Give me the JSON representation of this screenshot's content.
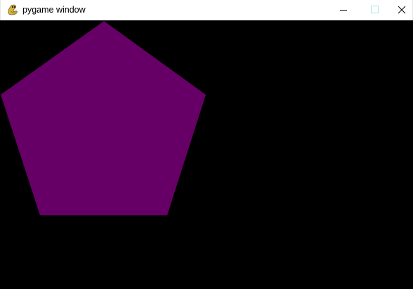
{
  "window": {
    "title": "pygame window",
    "icon": "pygame-snake-icon"
  },
  "controls": {
    "minimize_icon": "minimize-icon",
    "maximize_icon": "maximize-icon",
    "close_icon": "close-icon"
  },
  "canvas": {
    "background_color": "#000000",
    "shapes": [
      {
        "type": "pentagon",
        "fill_color": "#660066"
      }
    ]
  }
}
